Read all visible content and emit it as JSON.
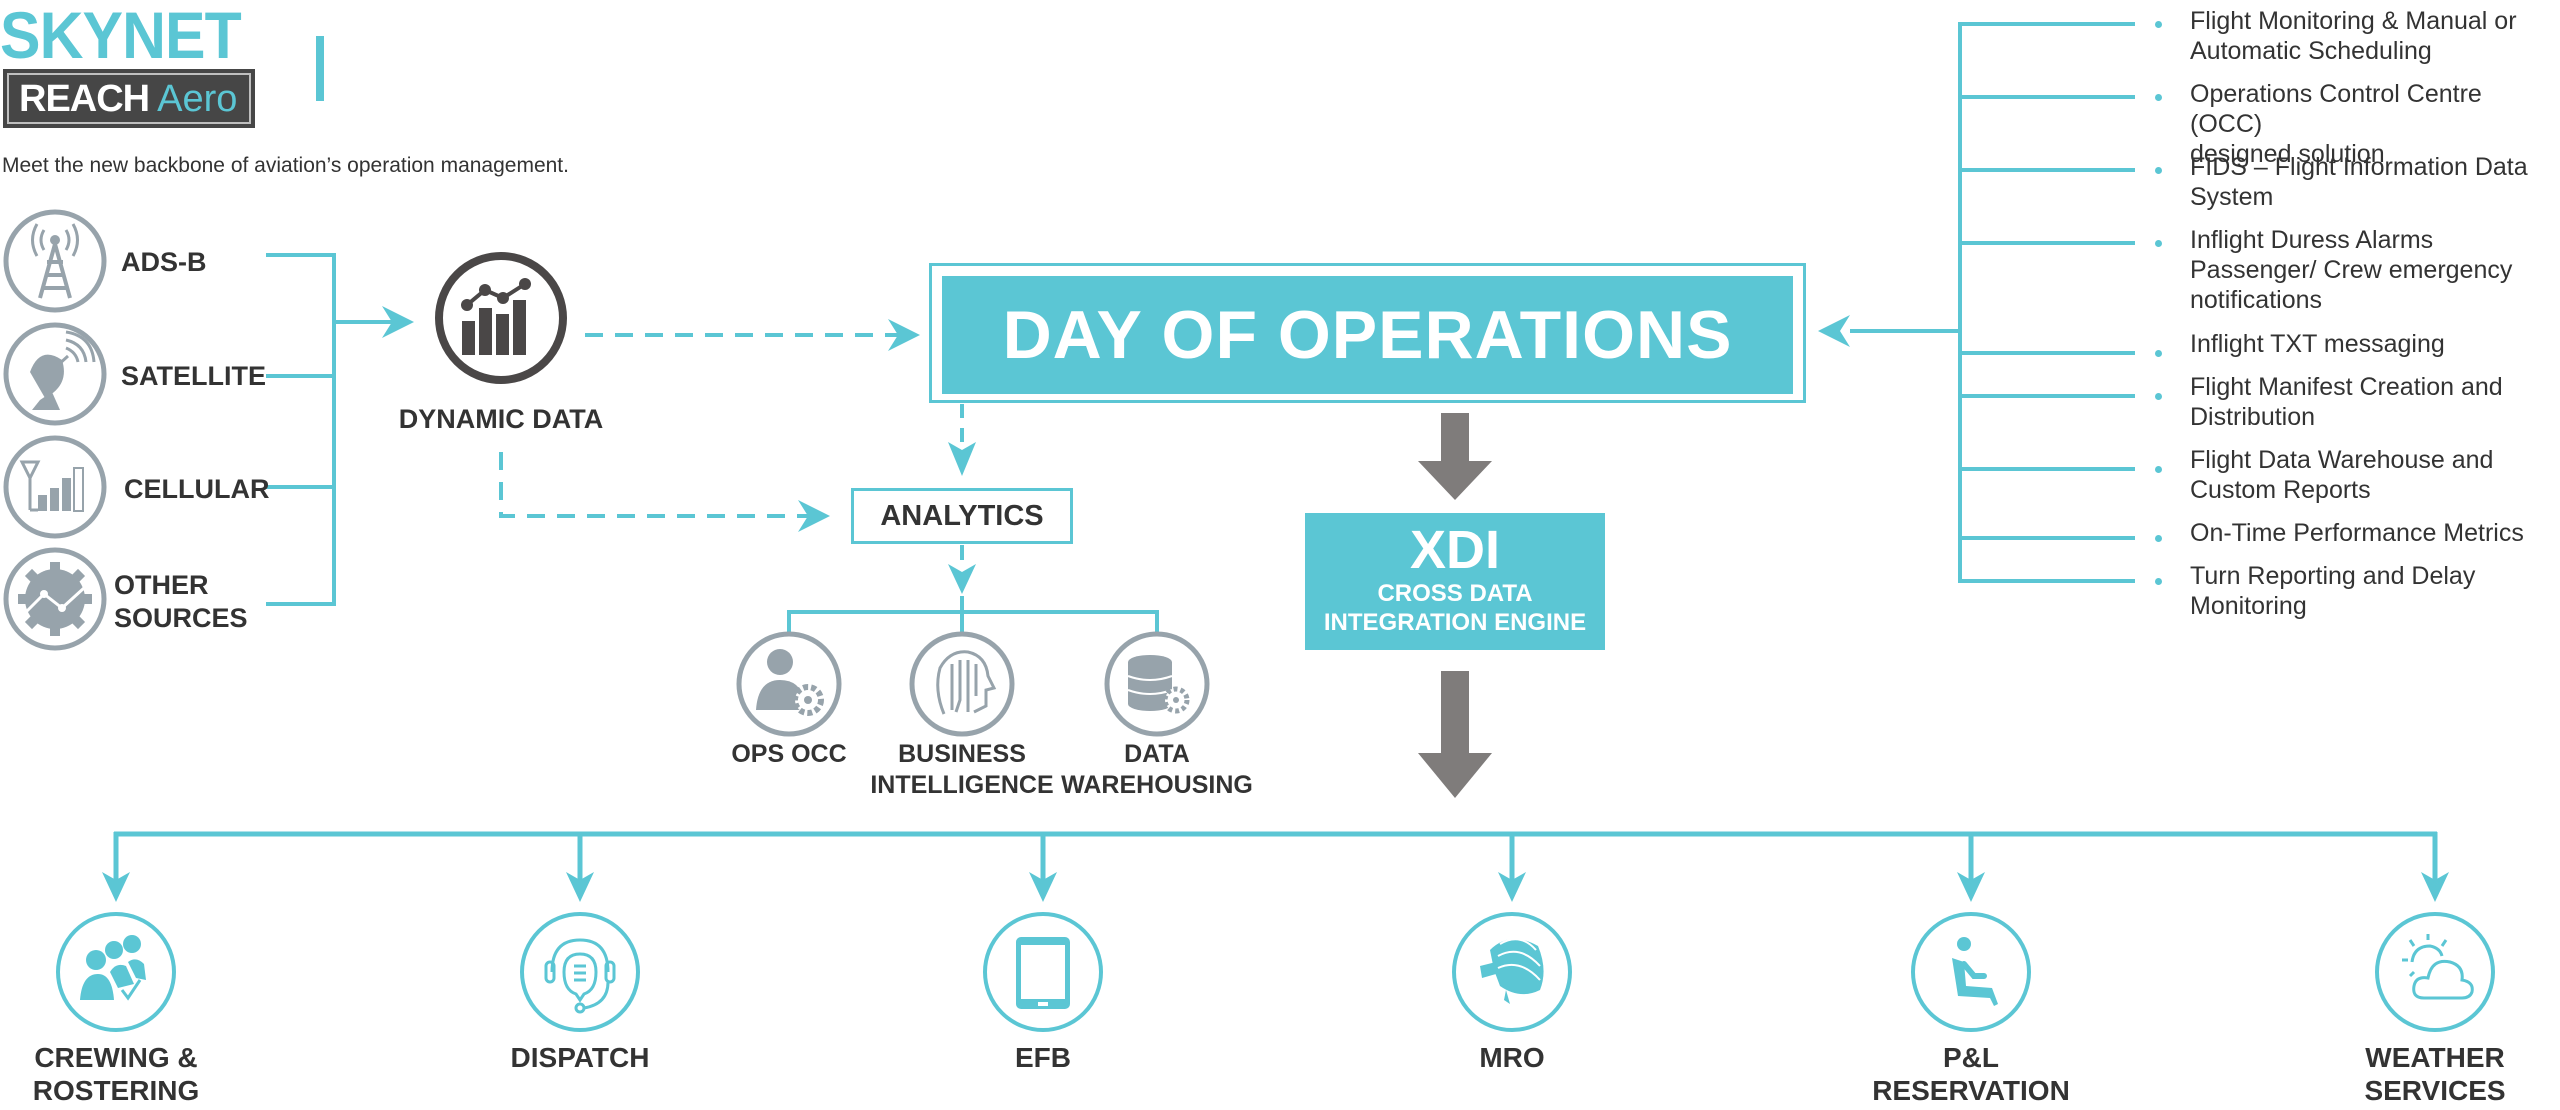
{
  "brand": {
    "name_top": "SKYNET",
    "name_bold": "REACH",
    "name_light": "Aero",
    "tagline": "Meet the new backbone of aviation’s operation management."
  },
  "colors": {
    "accent": "#5BC6D4",
    "text": "#333333",
    "icon_gray": "#97A3AB",
    "arrow_gray": "#7F7C7B",
    "logo_bg": "#464646"
  },
  "sources": [
    {
      "label_lines": [
        "ADS-B"
      ],
      "icon": "radio-tower-icon"
    },
    {
      "label_lines": [
        "SATELLITE"
      ],
      "icon": "satellite-dish-icon"
    },
    {
      "label_lines": [
        "CELLULAR"
      ],
      "icon": "cellular-signal-icon"
    },
    {
      "label_lines": [
        "OTHER",
        "SOURCES"
      ],
      "icon": "gear-chart-icon"
    }
  ],
  "dynamic_data": {
    "label": "DYNAMIC DATA",
    "icon": "bar-line-chart-icon"
  },
  "day_of_operations": {
    "label": "DAY OF OPERATIONS"
  },
  "analytics": {
    "label": "ANALYTICS",
    "children": [
      {
        "label_lines": [
          "OPS OCC"
        ],
        "icon": "user-gear-icon"
      },
      {
        "label_lines": [
          "BUSINESS",
          "INTELLIGENCE"
        ],
        "icon": "brain-circuit-icon"
      },
      {
        "label_lines": [
          "DATA",
          "WAREHOUSING"
        ],
        "icon": "database-gear-icon"
      }
    ]
  },
  "xdi": {
    "title": "XDI",
    "subtitle_lines": [
      "CROSS DATA",
      "INTEGRATION ENGINE"
    ]
  },
  "features": [
    {
      "lines": [
        "Flight Monitoring & Manual or",
        "Automatic Scheduling"
      ]
    },
    {
      "lines": [
        "Operations Control Centre (OCC)",
        "designed solution"
      ]
    },
    {
      "lines": [
        "FIDS – Flight Information Data",
        "System"
      ]
    },
    {
      "lines": [
        "Inflight Duress Alarms",
        "Passenger/ Crew emergency",
        "notifications"
      ]
    },
    {
      "lines": [
        "Inflight TXT messaging"
      ]
    },
    {
      "lines": [
        "Flight Manifest Creation and",
        "Distribution"
      ]
    },
    {
      "lines": [
        "Flight Data Warehouse and",
        "Custom Reports"
      ]
    },
    {
      "lines": [
        "On-Time Performance Metrics"
      ]
    },
    {
      "lines": [
        "Turn Reporting and Delay",
        "Monitoring"
      ]
    }
  ],
  "outputs": [
    {
      "label_lines": [
        "CREWING &",
        "ROSTERING"
      ],
      "icon": "crew-group-icon"
    },
    {
      "label_lines": [
        "DISPATCH"
      ],
      "icon": "headset-chat-icon"
    },
    {
      "label_lines": [
        "EFB"
      ],
      "icon": "tablet-icon"
    },
    {
      "label_lines": [
        "MRO"
      ],
      "icon": "wrench-engine-icon"
    },
    {
      "label_lines": [
        "P&L",
        "RESERVATION"
      ],
      "icon": "passenger-seat-icon"
    },
    {
      "label_lines": [
        "WEATHER",
        "SERVICES"
      ],
      "icon": "sun-cloud-icon"
    }
  ]
}
